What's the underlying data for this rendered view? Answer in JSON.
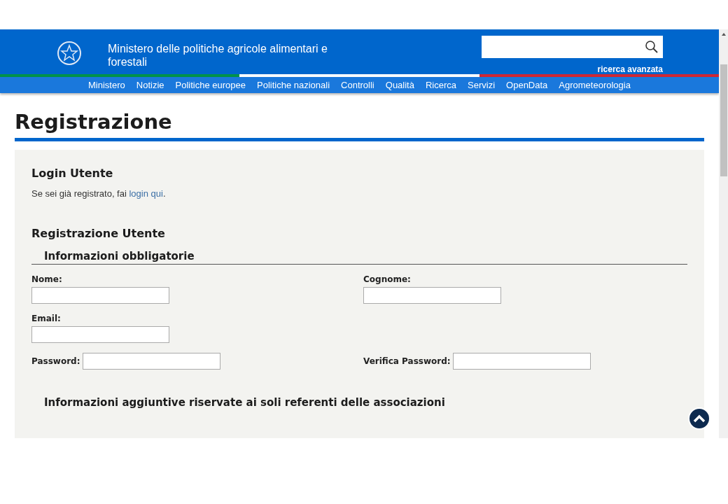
{
  "header": {
    "title": "Ministero delle politiche agricole alimentari e forestali",
    "advanced_search": "ricerca avanzata"
  },
  "nav": [
    "Ministero",
    "Notizie",
    "Politiche europee",
    "Politiche nazionali",
    "Controlli",
    "Qualità",
    "Ricerca",
    "Servizi",
    "OpenData",
    "Agrometeorologia"
  ],
  "page_title": "Registrazione",
  "login": {
    "heading": "Login Utente",
    "text": "Se sei già registrato, fai ",
    "link": "login qui",
    "after": "."
  },
  "registration": {
    "heading": "Registrazione Utente",
    "section": "Informazioni obbligatorie",
    "rows": [
      [
        {
          "label": "Nome:",
          "kind": "stacked"
        },
        {
          "label": "Cognome:",
          "kind": "stacked"
        }
      ],
      [
        {
          "label": "Email:",
          "kind": "stacked"
        }
      ],
      [
        {
          "label": "Password:",
          "kind": "inline"
        },
        {
          "label": "Verifica Password:",
          "kind": "inline"
        }
      ]
    ],
    "section_2": "Informazioni aggiuntive riservate ai soli referenti delle associazioni"
  }
}
